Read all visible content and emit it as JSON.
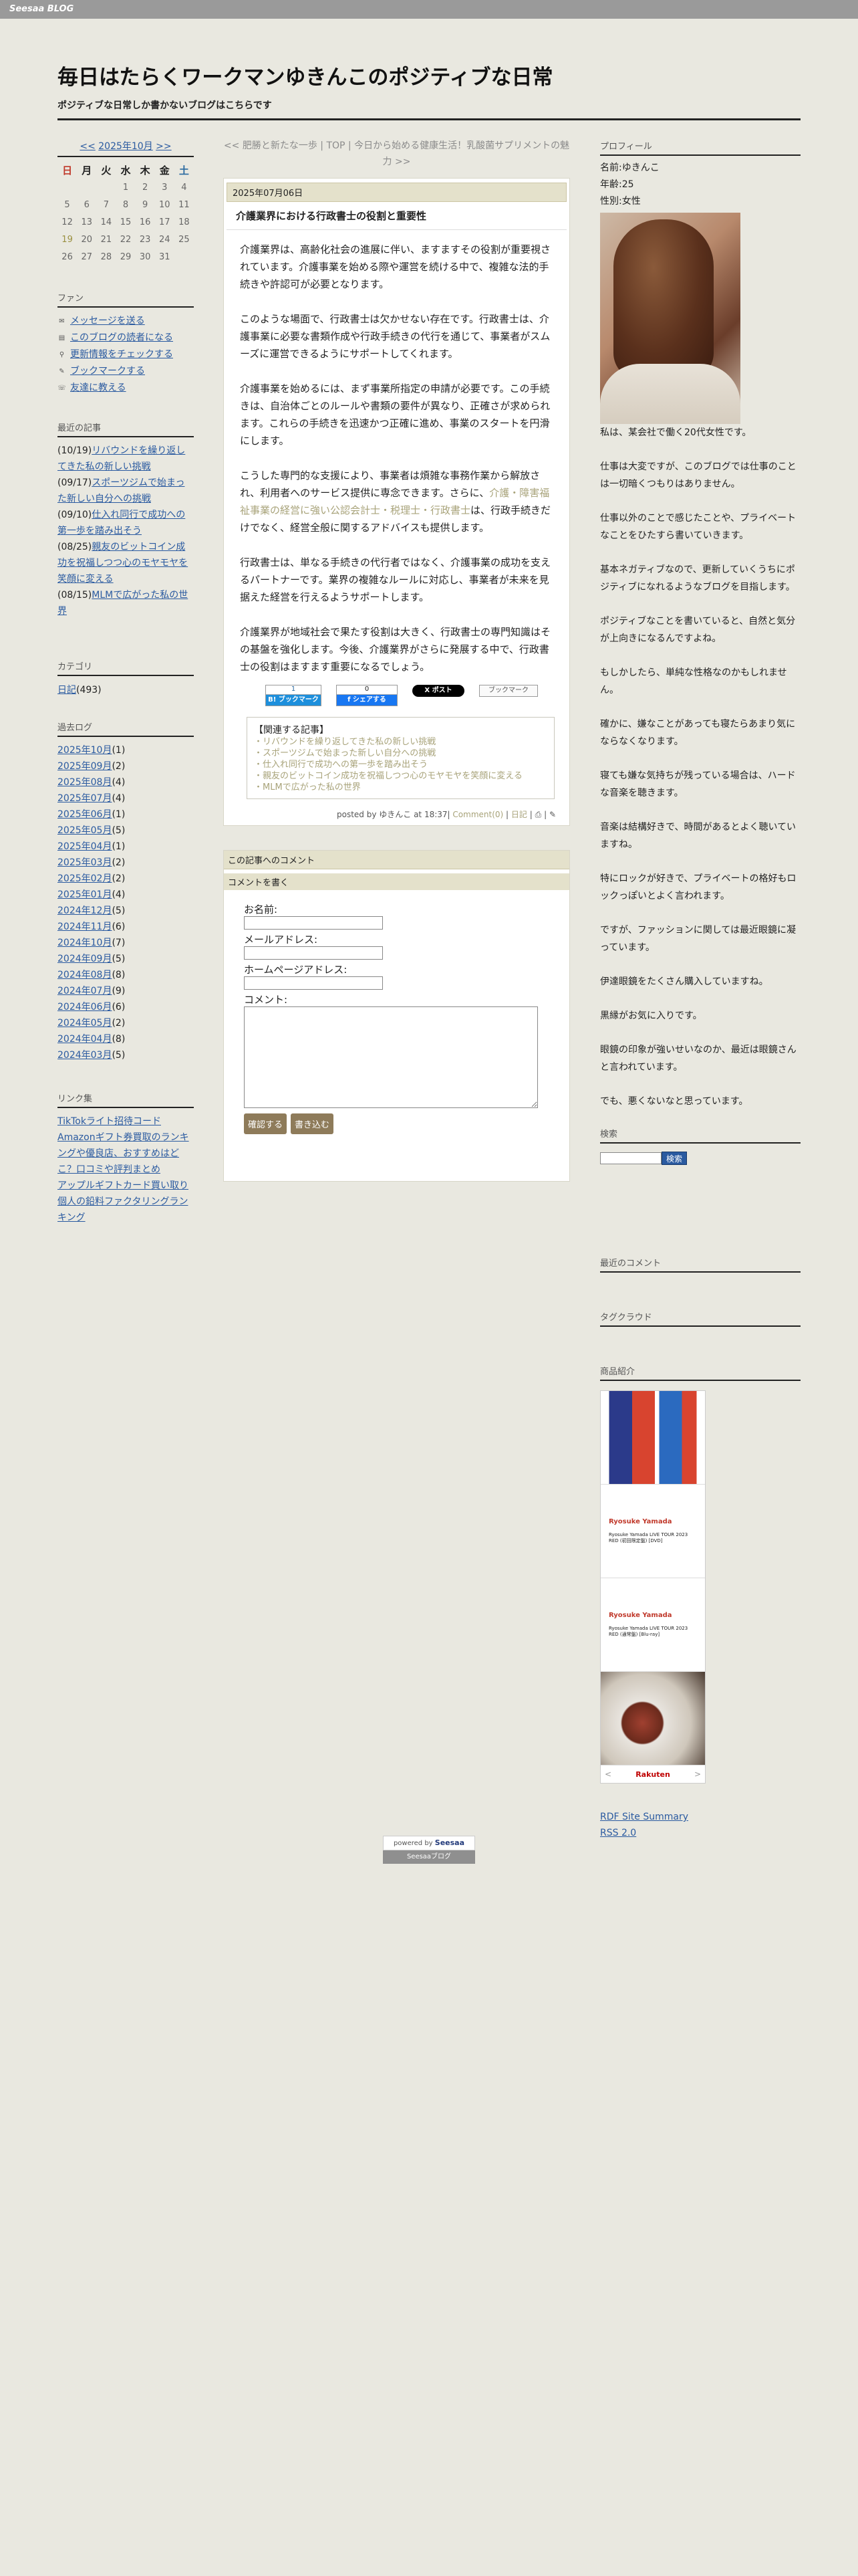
{
  "topbar": {
    "brand": "Seesaa BLOG"
  },
  "site": {
    "title": "毎日はたらくワークマンゆきんこのポジティブな日常",
    "description": "ポジティブな日常しか書かないブログはこちらです"
  },
  "calendar": {
    "prev": "<<",
    "month": "2025年10月",
    "next": ">>",
    "weekdays": [
      "日",
      "月",
      "火",
      "水",
      "木",
      "金",
      "土"
    ],
    "rows": [
      [
        "",
        "",
        "",
        "1",
        "2",
        "3",
        "4"
      ],
      [
        "5",
        "6",
        "7",
        "8",
        "9",
        "10",
        "11"
      ],
      [
        "12",
        "13",
        "14",
        "15",
        "16",
        "17",
        "18"
      ],
      [
        "19",
        "20",
        "21",
        "22",
        "23",
        "24",
        "25"
      ],
      [
        "26",
        "27",
        "28",
        "29",
        "30",
        "31",
        ""
      ]
    ]
  },
  "fan": {
    "heading": "ファン",
    "items": [
      "メッセージを送る",
      "このブログの読者になる",
      "更新情報をチェックする",
      "ブックマークする",
      "友達に教える"
    ]
  },
  "recent": {
    "heading": "最近の記事",
    "items": [
      {
        "date": "(10/19)",
        "title": "リバウンドを繰り返してきた私の新しい挑戦"
      },
      {
        "date": "(09/17)",
        "title": "スポーツジムで始まった新しい自分への挑戦"
      },
      {
        "date": "(09/10)",
        "title": "仕入れ同行で成功への第一歩を踏み出そう"
      },
      {
        "date": "(08/25)",
        "title": "親友のビットコイン成功を祝福しつつ心のモヤモヤを笑顔に変える"
      },
      {
        "date": "(08/15)",
        "title": "MLMで広がった私の世界"
      }
    ]
  },
  "category": {
    "heading": "カテゴリ",
    "label": "日記",
    "count": "(493)"
  },
  "archive": {
    "heading": "過去ログ",
    "items": [
      {
        "month": "2025年10月",
        "count": "(1)"
      },
      {
        "month": "2025年09月",
        "count": "(2)"
      },
      {
        "month": "2025年08月",
        "count": "(4)"
      },
      {
        "month": "2025年07月",
        "count": "(4)"
      },
      {
        "month": "2025年06月",
        "count": "(1)"
      },
      {
        "month": "2025年05月",
        "count": "(5)"
      },
      {
        "month": "2025年04月",
        "count": "(1)"
      },
      {
        "month": "2025年03月",
        "count": "(2)"
      },
      {
        "month": "2025年02月",
        "count": "(2)"
      },
      {
        "month": "2025年01月",
        "count": "(4)"
      },
      {
        "month": "2024年12月",
        "count": "(5)"
      },
      {
        "month": "2024年11月",
        "count": "(6)"
      },
      {
        "month": "2024年10月",
        "count": "(7)"
      },
      {
        "month": "2024年09月",
        "count": "(5)"
      },
      {
        "month": "2024年08月",
        "count": "(8)"
      },
      {
        "month": "2024年07月",
        "count": "(9)"
      },
      {
        "month": "2024年06月",
        "count": "(6)"
      },
      {
        "month": "2024年05月",
        "count": "(2)"
      },
      {
        "month": "2024年04月",
        "count": "(8)"
      },
      {
        "month": "2024年03月",
        "count": "(5)"
      }
    ]
  },
  "links": {
    "heading": "リンク集",
    "items": [
      "TikTokライト招待コード",
      "Amazonギフト券買取のランキングや優良店、おすすめはどこ？口コミや評判まとめ",
      "アップルギフトカード買い取り",
      "個人の鉛料ファクタリングランキング"
    ]
  },
  "post_nav": {
    "prev": "<< 肥勝と新たな一歩",
    "top": "TOP",
    "next": "今日から始める健康生活！乳酸菌サプリメントの魅力 >>"
  },
  "article": {
    "date": "2025年07月06日",
    "title": "介護業界における行政書士の役割と重要性",
    "p1": "介護業界は、高齢化社会の進展に伴い、ますますその役割が重要視されています。介護事業を始める際や運営を続ける中で、複雑な法的手続きや許認可が必要となります。",
    "p2": "このような場面で、行政書士は欠かせない存在です。行政書士は、介護事業に必要な書類作成や行政手続きの代行を通じて、事業者がスムーズに運営できるようにサポートしてくれます。",
    "p3": "介護事業を始めるには、まず事業所指定の申請が必要です。この手続きは、自治体ごとのルールや書類の要件が異なり、正確さが求められます。これらの手続きを迅速かつ正確に進め、事業のスタートを円滑にします。",
    "p4_pre": "こうした専門的な支援により、事業者は煩雑な事務作業から解放され、利用者へのサービス提供に専念できます。さらに、",
    "p4_link": "介護・障害福祉事業の経営に強い公認会計士・税理士・行政書士",
    "p4_post": "は、行政手続きだけでなく、経営全般に関するアドバイスも提供します。",
    "p5": "行政書士は、単なる手続きの代行者ではなく、介護事業の成功を支えるパートナーです。業界の複雑なルールに対応し、事業者が未来を見据えた経営を行えるようサポートします。",
    "p6": "介護業界が地域社会で果たす役割は大きく、行政書士の専門知識はその基盤を強化します。今後、介護業界がさらに発展する中で、行政書士の役割はますます重要になるでしょう。"
  },
  "share": {
    "hatena_count": "1",
    "hatena_label": "B! ブックマーク",
    "fb_count": "0",
    "fb_label": "f シェアする",
    "x_label": "X ポスト",
    "gbm_label": "ブックマーク"
  },
  "related": {
    "heading": "【関連する記事】",
    "items": [
      "リバウンドを繰り返してきた私の新しい挑戦",
      "スポーツジムで始まった新しい自分への挑戦",
      "仕入れ同行で成功への第一歩を踏み出そう",
      "親友のビットコイン成功を祝福しつつ心のモヤモヤを笑顔に変える",
      "MLMで広がった私の世界"
    ]
  },
  "posted": {
    "by": "posted by ゆきんこ at 18:37|",
    "comment": "Comment(0)",
    "cat": "日記",
    "sep": "|"
  },
  "comments": {
    "heading": "この記事へのコメント",
    "write_heading": "コメントを書く",
    "name_label": "お名前:",
    "mail_label": "メールアドレス:",
    "hp_label": "ホームページアドレス:",
    "comment_label": "コメント:",
    "confirm_btn": "確認する",
    "submit_btn": "書き込む"
  },
  "profile": {
    "heading": "プロフィール",
    "name": "名前:ゆきんこ",
    "age": "年齢:25",
    "gender": "性別:女性",
    "paragraphs": [
      "私は、某会社で働く20代女性です。",
      "仕事は大変ですが、このブログでは仕事のことは一切暗くつもりはありません。",
      "仕事以外のことで感じたことや、プライベートなことをひたすら書いていきます。",
      "基本ネガティブなので、更新していくうちにポジティブになれるようなブログを目指します。",
      "ポジティブなことを書いていると、自然と気分が上向きになるんですよね。",
      "もしかしたら、単純な性格なのかもしれません。",
      "確かに、嫌なことがあっても寝たらあまり気にならなくなります。",
      "寝ても嫌な気持ちが残っている場合は、ハードな音楽を聴きます。",
      "音楽は結構好きで、時間があるとよく聴いていますね。",
      "特にロックが好きで、プライベートの格好もロックっぽいとよく言われます。",
      "ですが、ファッションに関しては最近眼鏡に凝っています。",
      "伊達眼鏡をたくさん購入していますね。",
      "黒縁がお気に入りです。",
      "眼鏡の印象が強いせいなのか、最近は眼鏡さんと言われています。",
      "でも、悪くないなと思っています。"
    ]
  },
  "search": {
    "heading": "検索",
    "button": "検索"
  },
  "right_widgets": {
    "recent_comments": "最近のコメント",
    "tag_cloud": "タグクラウド",
    "products": "商品紹介"
  },
  "products": {
    "item2_title": "Ryosuke Yamada",
    "item2_text": "Ryosuke Yamada LIVE TOUR 2023 RED (初回限定盤) [DVD]",
    "item3_title": "Ryosuke Yamada",
    "item3_text": "Ryosuke Yamada LIVE TOUR 2023 RED (通常盤) [Blu-ray]",
    "rakuten": "Rakuten",
    "prev": "<",
    "next": ">"
  },
  "feeds": {
    "rdf": "RDF Site Summary",
    "rss": "RSS 2.0"
  },
  "footer": {
    "powered_label": "powered by",
    "powered_brand": "Seesaa",
    "blog_label": "Seesaaブログ"
  }
}
